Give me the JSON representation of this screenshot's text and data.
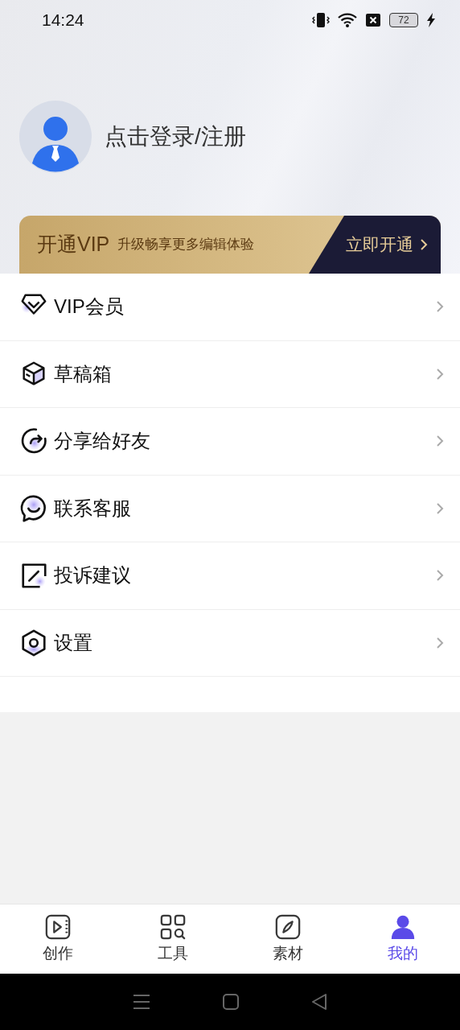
{
  "status_bar": {
    "time": "14:24",
    "battery": "72"
  },
  "profile": {
    "login_text": "点击登录/注册"
  },
  "vip_banner": {
    "title": "开通VIP",
    "subtitle": "升级畅享更多编辑体验",
    "action": "立即开通"
  },
  "menu": [
    {
      "label": "VIP会员"
    },
    {
      "label": "草稿箱"
    },
    {
      "label": "分享给好友"
    },
    {
      "label": "联系客服"
    },
    {
      "label": "投诉建议"
    },
    {
      "label": "设置"
    }
  ],
  "tabs": [
    {
      "label": "创作",
      "selected": false
    },
    {
      "label": "工具",
      "selected": false
    },
    {
      "label": "素材",
      "selected": false
    },
    {
      "label": "我的",
      "selected": true
    }
  ]
}
